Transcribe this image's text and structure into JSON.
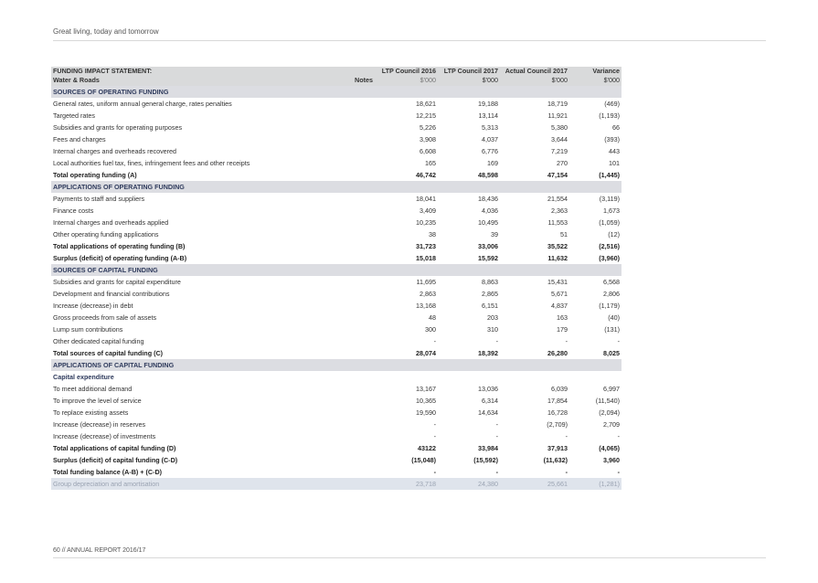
{
  "page": {
    "header": "Great living, today and tomorrow",
    "footer": "60 // ANNUAL REPORT 2016/17"
  },
  "table": {
    "title_line1": "FUNDING IMPACT STATEMENT:",
    "title_line2": "Water & Roads",
    "notes_label": "Notes",
    "columns": [
      {
        "name": "LTP Council 2016",
        "unit": "$'000"
      },
      {
        "name": "LTP Council 2017",
        "unit": "$'000"
      },
      {
        "name": "Actual Council 2017",
        "unit": "$'000"
      },
      {
        "name": "Variance",
        "unit": "$'000"
      }
    ],
    "rows": [
      {
        "type": "section",
        "label": "SOURCES OF OPERATING FUNDING",
        "values": [
          "",
          "",
          "",
          ""
        ]
      },
      {
        "type": "normal",
        "label": "General rates, uniform annual general charge, rates penalties",
        "values": [
          "18,621",
          "19,188",
          "18,719",
          "(469)"
        ]
      },
      {
        "type": "normal",
        "label": "Targeted rates",
        "values": [
          "12,215",
          "13,114",
          "11,921",
          "(1,193)"
        ]
      },
      {
        "type": "normal",
        "label": "Subsidies and grants for operating purposes",
        "values": [
          "5,226",
          "5,313",
          "5,380",
          "66"
        ]
      },
      {
        "type": "normal",
        "label": "Fees and charges",
        "values": [
          "3,908",
          "4,037",
          "3,644",
          "(393)"
        ]
      },
      {
        "type": "normal",
        "label": "Internal charges and overheads recovered",
        "values": [
          "6,608",
          "6,776",
          "7,219",
          "443"
        ]
      },
      {
        "type": "normal",
        "label": "Local authorities fuel tax, fines, infringement fees and other receipts",
        "values": [
          "165",
          "169",
          "270",
          "101"
        ]
      },
      {
        "type": "bold",
        "label": "Total operating funding (A)",
        "values": [
          "46,742",
          "48,598",
          "47,154",
          "(1,445)"
        ]
      },
      {
        "type": "section",
        "label": "APPLICATIONS OF OPERATING FUNDING",
        "values": [
          "",
          "",
          "",
          ""
        ]
      },
      {
        "type": "normal",
        "label": "Payments to staff and suppliers",
        "values": [
          "18,041",
          "18,436",
          "21,554",
          "(3,119)"
        ]
      },
      {
        "type": "normal",
        "label": "Finance costs",
        "values": [
          "3,409",
          "4,036",
          "2,363",
          "1,673"
        ]
      },
      {
        "type": "normal",
        "label": "Internal charges and overheads applied",
        "values": [
          "10,235",
          "10,495",
          "11,553",
          "(1,059)"
        ]
      },
      {
        "type": "normal",
        "label": "Other operating funding applications",
        "values": [
          "38",
          "39",
          "51",
          "(12)"
        ]
      },
      {
        "type": "bold",
        "label": "Total applications of operating funding (B)",
        "values": [
          "31,723",
          "33,006",
          "35,522",
          "(2,516)"
        ]
      },
      {
        "type": "bold",
        "label": "Surplus (deficit) of operating funding (A-B)",
        "values": [
          "15,018",
          "15,592",
          "11,632",
          "(3,960)"
        ]
      },
      {
        "type": "section",
        "label": "SOURCES OF CAPITAL FUNDING",
        "values": [
          "",
          "",
          "",
          ""
        ]
      },
      {
        "type": "normal",
        "label": "Subsidies and grants for capital expenditure",
        "values": [
          "11,695",
          "8,863",
          "15,431",
          "6,568"
        ]
      },
      {
        "type": "normal",
        "label": "Development and financial contributions",
        "values": [
          "2,863",
          "2,865",
          "5,671",
          "2,806"
        ]
      },
      {
        "type": "normal",
        "label": "Increase (decrease) in debt",
        "values": [
          "13,168",
          "6,151",
          "4,837",
          "(1,179)"
        ]
      },
      {
        "type": "normal",
        "label": "Gross proceeds from sale of assets",
        "values": [
          "48",
          "203",
          "163",
          "(40)"
        ]
      },
      {
        "type": "normal",
        "label": "Lump sum contributions",
        "values": [
          "300",
          "310",
          "179",
          "(131)"
        ]
      },
      {
        "type": "normal",
        "label": "Other dedicated capital funding",
        "values": [
          "-",
          "-",
          "-",
          "-"
        ]
      },
      {
        "type": "bold",
        "label": "Total sources of capital funding (C)",
        "values": [
          "28,074",
          "18,392",
          "26,280",
          "8,025"
        ]
      },
      {
        "type": "section",
        "label": "APPLICATIONS OF CAPITAL FUNDING",
        "values": [
          "",
          "",
          "",
          ""
        ]
      },
      {
        "type": "subhead",
        "label": "Capital expenditure",
        "values": [
          "",
          "",
          "",
          ""
        ]
      },
      {
        "type": "normal",
        "label": "To meet additional demand",
        "values": [
          "13,167",
          "13,036",
          "6,039",
          "6,997"
        ]
      },
      {
        "type": "normal",
        "label": "To improve the level of service",
        "values": [
          "10,365",
          "6,314",
          "17,854",
          "(11,540)"
        ]
      },
      {
        "type": "normal",
        "label": "To replace existing assets",
        "values": [
          "19,590",
          "14,634",
          "16,728",
          "(2,094)"
        ]
      },
      {
        "type": "normal",
        "label": "Increase (decrease) in reserves",
        "values": [
          "-",
          "-",
          "(2,709)",
          "2,709"
        ]
      },
      {
        "type": "normal",
        "label": "Increase (decrease) of investments",
        "values": [
          "-",
          "-",
          "-",
          "-"
        ]
      },
      {
        "type": "bold",
        "label": "Total applications of capital funding (D)",
        "values": [
          "43122",
          "33,984",
          "37,913",
          "(4,065)"
        ]
      },
      {
        "type": "bold",
        "label": "Surplus (deficit) of capital funding (C-D)",
        "values": [
          "(15,048)",
          "(15,592)",
          "(11,632)",
          "3,960"
        ]
      },
      {
        "type": "bold",
        "label": "Total funding balance (A-B) + (C-D)",
        "values": [
          "-",
          "-",
          "-",
          "-"
        ]
      },
      {
        "type": "muted",
        "label": "Group depreciation and amortisation",
        "values": [
          "23,718",
          "24,380",
          "25,661",
          "(1,281)"
        ]
      }
    ]
  }
}
